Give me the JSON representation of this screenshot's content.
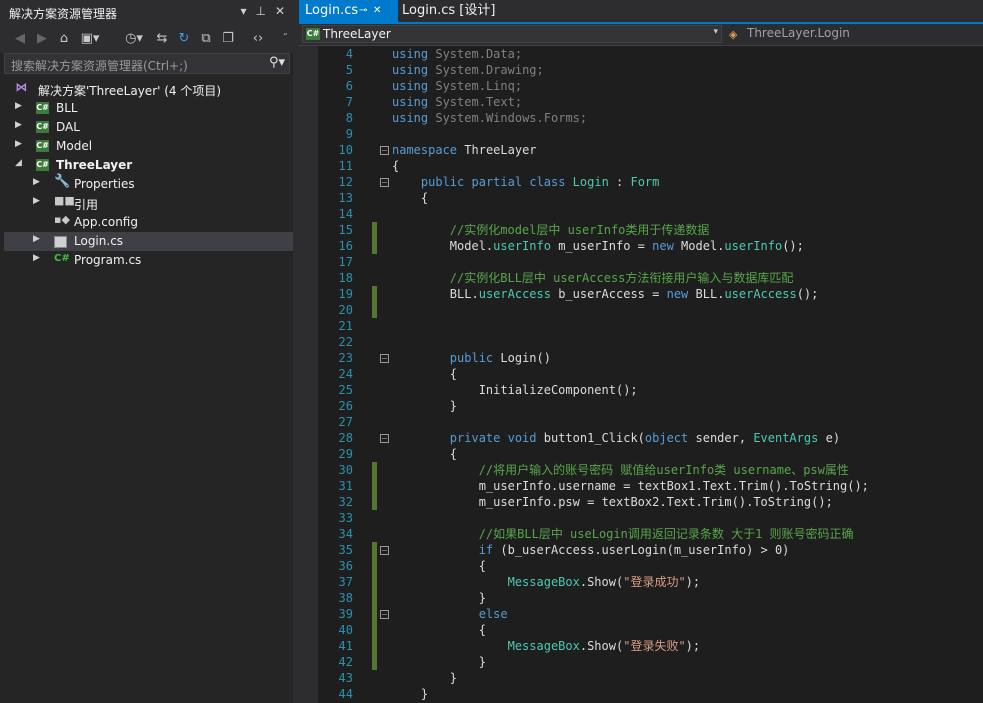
{
  "solution_explorer": {
    "title": "解决方案资源管理器",
    "search_placeholder": "搜索解决方案资源管理器(Ctrl+;)",
    "title_buttons": [
      "▾",
      "📌",
      "✕"
    ],
    "tree": [
      {
        "label": "解决方案'ThreeLayer' (4 个项目)",
        "icon": "solution-icon",
        "level": 0
      },
      {
        "label": "BLL",
        "icon": "csharp-project-icon",
        "level": 1
      },
      {
        "label": "DAL",
        "icon": "csharp-project-icon",
        "level": 1
      },
      {
        "label": "Model",
        "icon": "csharp-project-icon",
        "level": 1
      },
      {
        "label": "ThreeLayer",
        "icon": "csharp-project-icon",
        "level": 1
      },
      {
        "label": "Properties",
        "icon": "wrench-icon",
        "level": 2
      },
      {
        "label": "引用",
        "icon": "references-icon",
        "level": 2
      },
      {
        "label": "App.config",
        "icon": "config-icon",
        "level": 2
      },
      {
        "label": "Login.cs",
        "icon": "form-icon",
        "level": 2
      },
      {
        "label": "Program.cs",
        "icon": "csharp-file-icon",
        "level": 2
      }
    ]
  },
  "editor": {
    "tabs": [
      {
        "label": "Login.cs",
        "pin": "⊕",
        "close": "✕"
      },
      {
        "label": "Login.cs [设计]"
      }
    ],
    "nav_left": "ThreeLayer",
    "nav_right": "ThreeLayer.Login",
    "lines": [
      {
        "n": "4",
        "t": "using System.Data;"
      },
      {
        "n": "5",
        "t": "using System.Drawing;"
      },
      {
        "n": "6",
        "t": "using System.Linq;"
      },
      {
        "n": "7",
        "t": "using System.Text;"
      },
      {
        "n": "8",
        "t": "using System.Windows.Forms;"
      },
      {
        "n": "9",
        "t": ""
      },
      {
        "n": "10",
        "t": "namespace ThreeLayer"
      },
      {
        "n": "11",
        "t": "{"
      },
      {
        "n": "12",
        "t": "    public partial class Login : Form"
      },
      {
        "n": "13",
        "t": "    {"
      },
      {
        "n": "14",
        "t": ""
      },
      {
        "n": "15",
        "t": "        //实例化model层中 userInfo类用于传递数据"
      },
      {
        "n": "16",
        "t": "        Model.userInfo m_userInfo = new Model.userInfo();"
      },
      {
        "n": "17",
        "t": ""
      },
      {
        "n": "18",
        "t": "        //实例化BLL层中 userAccess方法衔接用户输入与数据库匹配"
      },
      {
        "n": "19",
        "t": "        BLL.userAccess b_userAccess = new BLL.userAccess();"
      },
      {
        "n": "20",
        "t": ""
      },
      {
        "n": "21",
        "t": ""
      },
      {
        "n": "22",
        "t": ""
      },
      {
        "n": "23",
        "t": "        public Login()"
      },
      {
        "n": "24",
        "t": "        {"
      },
      {
        "n": "25",
        "t": "            InitializeComponent();"
      },
      {
        "n": "26",
        "t": "        }"
      },
      {
        "n": "27",
        "t": ""
      },
      {
        "n": "28",
        "t": "        private void button1_Click(object sender, EventArgs e)"
      },
      {
        "n": "29",
        "t": "        {"
      },
      {
        "n": "30",
        "t": "            //将用户输入的账号密码 赋值给userInfo类 username、psw属性"
      },
      {
        "n": "31",
        "t": "            m_userInfo.username = textBox1.Text.Trim().ToString();"
      },
      {
        "n": "32",
        "t": "            m_userInfo.psw = textBox2.Text.Trim().ToString();"
      },
      {
        "n": "33",
        "t": ""
      },
      {
        "n": "34",
        "t": "            //如果BLL层中 useLogin调用返回记录条数 大于1 则账号密码正确"
      },
      {
        "n": "35",
        "t": "            if (b_userAccess.userLogin(m_userInfo) > 0)"
      },
      {
        "n": "36",
        "t": "            {"
      },
      {
        "n": "37",
        "t": "                MessageBox.Show(\"登录成功\");"
      },
      {
        "n": "38",
        "t": "            }"
      },
      {
        "n": "39",
        "t": "            else"
      },
      {
        "n": "40",
        "t": "            {"
      },
      {
        "n": "41",
        "t": "                MessageBox.Show(\"登录失败\");"
      },
      {
        "n": "42",
        "t": "            }"
      },
      {
        "n": "43",
        "t": "        }"
      },
      {
        "n": "44",
        "t": "    }"
      }
    ]
  },
  "colors": {
    "keyword": "#569cd6",
    "type": "#4ec9b0",
    "comment": "#57a64a",
    "string": "#d69d85",
    "line_number": "#2b91af",
    "accent": "#007acc",
    "change_bar": "#577430"
  }
}
